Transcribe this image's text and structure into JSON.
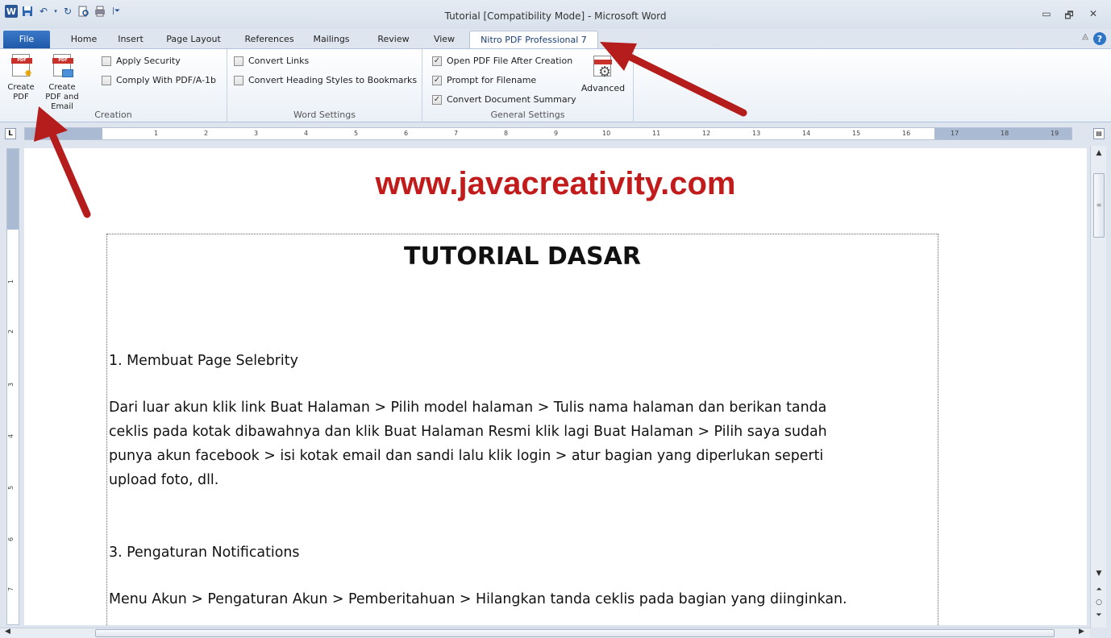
{
  "window": {
    "title": "Tutorial [Compatibility Mode] - Microsoft Word",
    "controls": {
      "minimize": "▭",
      "restore": "🗗",
      "close": "✕"
    }
  },
  "qat": {
    "app_icon": "W",
    "save": "💾",
    "undo": "↶",
    "redo": "↻",
    "print_preview": "🔍",
    "print": "🖶",
    "customize": "⏷"
  },
  "tabs": [
    {
      "label": "File"
    },
    {
      "label": "Home"
    },
    {
      "label": "Insert"
    },
    {
      "label": "Page Layout"
    },
    {
      "label": "References"
    },
    {
      "label": "Mailings"
    },
    {
      "label": "Review"
    },
    {
      "label": "View"
    },
    {
      "label": "Nitro PDF Professional 7"
    }
  ],
  "ribbon": {
    "creation": {
      "label": "Creation",
      "create_pdf": "Create PDF",
      "create_pdf_email": "Create PDF and Email",
      "apply_security": {
        "label": "Apply Security",
        "checked": false
      },
      "comply_pdfa": {
        "label": "Comply With PDF/A-1b",
        "checked": false
      }
    },
    "word_settings": {
      "label": "Word Settings",
      "convert_links": {
        "label": "Convert Links",
        "checked": false
      },
      "convert_headings": {
        "label": "Convert Heading Styles to Bookmarks",
        "checked": false
      }
    },
    "general_settings": {
      "label": "General Settings",
      "open_pdf": {
        "label": "Open PDF File After Creation",
        "checked": true
      },
      "prompt_filename": {
        "label": "Prompt for Filename",
        "checked": true
      },
      "convert_summary": {
        "label": "Convert Document Summary",
        "checked": true
      },
      "advanced": "Advanced"
    }
  },
  "ruler": {
    "tab_selector": "L",
    "h_numbers": [
      "1",
      "2",
      "3",
      "4",
      "5",
      "6",
      "7",
      "8",
      "9",
      "10",
      "11",
      "12",
      "13",
      "14",
      "15",
      "16",
      "17",
      "18",
      "19"
    ],
    "v_numbers": [
      "1",
      "1",
      "2",
      "3",
      "4",
      "5",
      "6",
      "7"
    ]
  },
  "document": {
    "watermark": "www.javacreativity.com",
    "heading": "TUTORIAL DASAR",
    "section1_title": "1. Membuat Page Selebrity",
    "section1_body_lines": [
      "Dari luar akun klik link Buat Halaman > Pilih model halaman > Tulis nama halaman dan berikan tanda",
      "ceklis pada kotak dibawahnya dan klik Buat Halaman Resmi klik lagi Buat Halaman > Pilih saya sudah",
      "punya akun facebook > isi kotak email dan sandi lalu klik login > atur bagian yang diperlukan seperti",
      "upload foto, dll."
    ],
    "section3_title": "3. Pengaturan Notifications",
    "section3_body": "Menu Akun > Pengaturan Akun > Pemberitahuan > Hilangkan tanda ceklis pada bagian yang diinginkan."
  },
  "colors": {
    "accent": "#2b5797",
    "watermark": "#c21b1b",
    "arrow": "#b51d1d"
  }
}
